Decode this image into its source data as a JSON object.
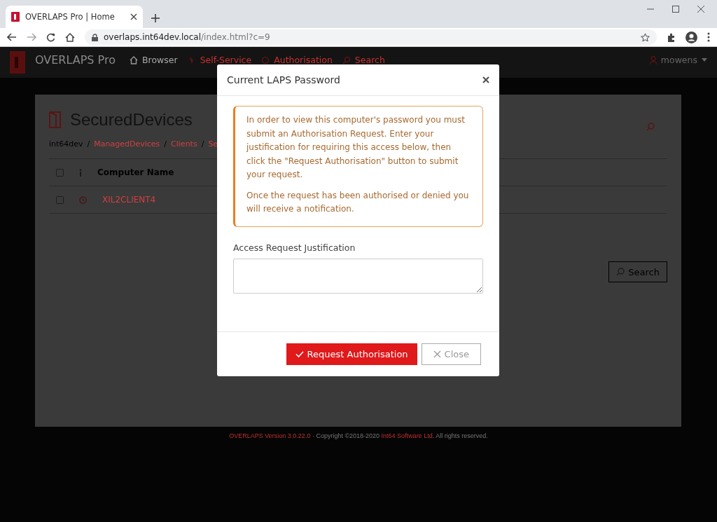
{
  "browser": {
    "tab_title": "OVERLAPS Pro | Home",
    "url_host": "overlaps.int64dev.local",
    "url_path": "/index.html?c=9"
  },
  "navbar": {
    "brand": "OVERLAPS Pro",
    "items": [
      {
        "label": "Browser",
        "kind": "home"
      },
      {
        "label": "Self-Service",
        "kind": "tool"
      },
      {
        "label": "Authorisation",
        "kind": "lock"
      },
      {
        "label": "Search",
        "kind": "search"
      }
    ],
    "user": "mowens"
  },
  "page": {
    "title": "SecuredDevices",
    "breadcrumb": [
      {
        "label": "int64dev",
        "kind": "text"
      },
      {
        "label": "/",
        "kind": "separator"
      },
      {
        "label": "ManagedDevices",
        "kind": "link"
      },
      {
        "label": "/",
        "kind": "separator"
      },
      {
        "label": "Clients",
        "kind": "link"
      },
      {
        "label": "/",
        "kind": "separator"
      },
      {
        "label": "Se",
        "kind": "link"
      }
    ],
    "header_checked": false,
    "column": "Computer Name",
    "rows": [
      {
        "name": "XIL2CLIENT4",
        "checked": false
      }
    ],
    "search_button": "Search"
  },
  "modal": {
    "title": "Current LAPS Password",
    "paragraphs": [
      "In order to view this computer's password you must submit an Authorisation Request. Enter your justification for requiring this access below, then click the \"Request Authorisation\" button to submit your request.",
      "Once the request has been authorised or denied you will receive a notification."
    ],
    "field_label": "Access Request Justification",
    "buttons": [
      {
        "label": "Request Authorisation",
        "kind": "primary"
      },
      {
        "label": "Close",
        "kind": "secondary"
      }
    ]
  },
  "footer": [
    {
      "text": "OVERLAPS Version 3.0.22.0",
      "kind": "link"
    },
    {
      "text": " · Copyright ©2018-2020 ",
      "kind": "text"
    },
    {
      "text": "Int64 Software Ltd",
      "kind": "link"
    },
    {
      "text": ". All rights reserved.",
      "kind": "text"
    }
  ]
}
